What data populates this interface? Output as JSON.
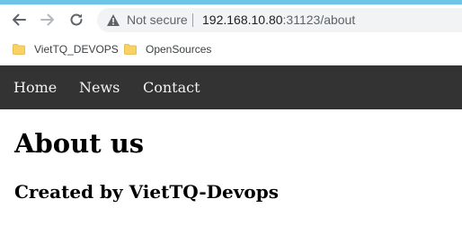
{
  "browser": {
    "security_label": "Not secure",
    "url_host": "192.168.10.80",
    "url_port_path": ":31123/about",
    "accent_color": "#6cc5e6",
    "icons": [
      "back-arrow-icon",
      "forward-arrow-icon",
      "reload-icon",
      "warning-icon",
      "folder-icon"
    ]
  },
  "bookmarks": [
    {
      "label": "VietTQ_DEVOPS"
    },
    {
      "label": "OpenSources"
    }
  ],
  "site_nav": {
    "background": "#333333",
    "items": [
      {
        "label": "Home"
      },
      {
        "label": "News"
      },
      {
        "label": "Contact"
      }
    ]
  },
  "content": {
    "title": "About us",
    "subtitle": "Created by VietTQ-Devops"
  }
}
